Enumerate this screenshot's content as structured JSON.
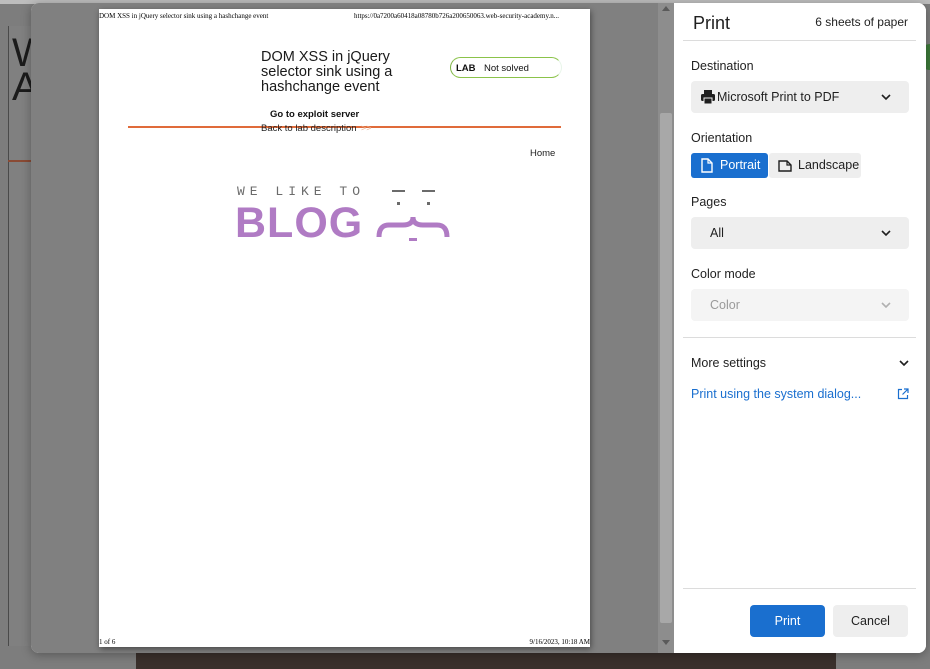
{
  "background": {
    "article_letters": "W A"
  },
  "print_preview": {
    "header_left": "DOM XSS in jQuery selector sink using a hashchange event",
    "header_right": "https://0a7200a60418a08780b726a200650063.web-security-academy.n...",
    "footer_left": "1 of 6",
    "footer_right": "9/16/2023, 10:18 AM",
    "lab_title": "DOM XSS in jQuery selector sink using a hashchange event",
    "lab_badge_label": "LAB",
    "lab_badge_status": "Not solved",
    "exploit_server_link": "Go to exploit server",
    "back_link": "Back to lab description",
    "back_chevrons": ">>",
    "home_link": "Home",
    "logo_tagline": "WE LIKE TO",
    "logo_word": "BLOG"
  },
  "panel": {
    "title": "Print",
    "sheets": "6 sheets of paper",
    "destination": {
      "label": "Destination",
      "value": "Microsoft Print to PDF"
    },
    "orientation": {
      "label": "Orientation",
      "portrait": "Portrait",
      "landscape": "Landscape",
      "selected": "Portrait"
    },
    "pages": {
      "label": "Pages",
      "value": "All"
    },
    "color_mode": {
      "label": "Color mode",
      "value": "Color"
    },
    "more_settings": "More settings",
    "system_dialog": "Print using the system dialog...",
    "print_button": "Print",
    "cancel_button": "Cancel"
  },
  "colors": {
    "accent": "#1a6fcf",
    "logo_purple": "#b07bc4",
    "lab_orange": "#e06b3a",
    "badge_green": "#8bc34a"
  },
  "icons": [
    "printer-icon",
    "chevron-down-icon",
    "portrait-page-icon",
    "landscape-page-icon",
    "external-link-icon",
    "scroll-up-arrow-icon",
    "scroll-down-arrow-icon"
  ]
}
